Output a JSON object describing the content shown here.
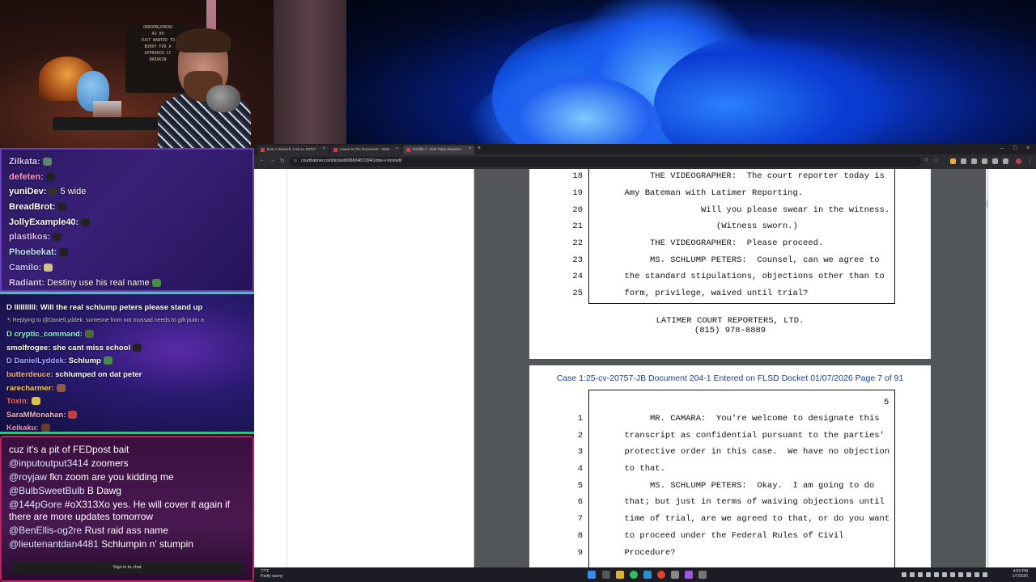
{
  "webcam": {
    "sign_lines": [
      "OKBOOBLEHEAD",
      "AS 80",
      "JUST WANTED TO",
      "BUDDY FOR A",
      "APPROACH CC",
      "BREAKIN"
    ]
  },
  "twitch_chat": [
    {
      "user": "Zilkata:",
      "text": "",
      "color": "#d8c0ff"
    },
    {
      "user": "defeten:",
      "text": "",
      "color": "#ff9ad0"
    },
    {
      "user": "yuniDev:",
      "text": "5 wide",
      "color": "#ffffff"
    },
    {
      "user": "BreadBrot:",
      "text": "",
      "color": "#ffffff"
    },
    {
      "user": "JollyExample40:",
      "text": "",
      "color": "#ffffff"
    },
    {
      "user": "plastikos:",
      "text": "",
      "color": "#e6b8ff"
    },
    {
      "user": "Phoebekat:",
      "text": "",
      "color": "#bfe2ff"
    },
    {
      "user": "Camilo:",
      "text": "",
      "color": "#c8c0ff"
    },
    {
      "user": "Radiant:",
      "text": "Destiny use his real name",
      "color": "#e0c8ff"
    }
  ],
  "twitch_chat2": [
    {
      "user": "D llllllllll:",
      "text": "Will the real schlump peters please stand up",
      "color": "#ffffff"
    },
    {
      "user": "",
      "text": "↰ Replying to @DanielLyddek: someone from not mossad needs to gift putin a",
      "color": "#cccccc"
    },
    {
      "user": "D cryptic_command:",
      "text": "",
      "color": "#7fffd4"
    },
    {
      "user": "smolfrogee:",
      "text": "she cant miss school",
      "color": "#ffffff"
    },
    {
      "user": "D DanielLyddek:",
      "text": "Schlump",
      "color": "#a8a8ff"
    },
    {
      "user": "butterdeuce:",
      "text": "schlumped on dat peter",
      "color": "#ffb07a"
    },
    {
      "user": "rarecharmer:",
      "text": "",
      "color": "#ffd070"
    },
    {
      "user": "Toxin:",
      "text": "",
      "color": "#ff6a6a"
    },
    {
      "user": "SaraMMonahan:",
      "text": "",
      "color": "#ffb0b0"
    },
    {
      "user": "Keikaku:",
      "text": "",
      "color": "#ff8ad0"
    }
  ],
  "youtube_chat": [
    {
      "user": "",
      "text": "cuz it's a pit of FEDpost bait"
    },
    {
      "user": "@inputoutput3414",
      "text": "zoomers"
    },
    {
      "user": "@royjaw",
      "text": "fkn zoom are you kidding me"
    },
    {
      "user": "@BulbSweetBulb",
      "text": "B Dawg"
    },
    {
      "user": "@144pGore",
      "text": "#oX313Xo yes. He will cover it again if"
    },
    {
      "user": "",
      "text": "there are more updates tomorrow"
    },
    {
      "user": "@BenEllis-og2re",
      "text": "Rust raid ass name"
    },
    {
      "user": "@lieutenantdan4481",
      "text": "Schlumpin n' stumpin"
    }
  ],
  "signin_label": "Sign in to chat",
  "browser": {
    "tabs": [
      {
        "title": "Doe v. Bonnell, 1:25-cv-20757"
      },
      {
        "title": "Leave to File Document - #204"
      },
      {
        "title": "Exhibit A - Non Party Depositi..."
      }
    ],
    "url": "courtlistener.com/docket/69650487/204/1/doe-v-bonnell/"
  },
  "document": {
    "page1_lines": [
      {
        "n": "18",
        "text": "          THE VIDEOGRAPHER:  The court reporter today is"
      },
      {
        "n": "19",
        "text": "     Amy Bateman with Latimer Reporting."
      },
      {
        "n": "20",
        "text": "                    Will you please swear in the witness."
      },
      {
        "n": "21",
        "text": "                       (Witness sworn.)"
      },
      {
        "n": "22",
        "text": "          THE VIDEOGRAPHER:  Please proceed."
      },
      {
        "n": "23",
        "text": "          MS. SCHLUMP PETERS:  Counsel, can we agree to"
      },
      {
        "n": "24",
        "text": "     the standard stipulations, objections other than to"
      },
      {
        "n": "25",
        "text": "     form, privilege, waived until trial?"
      }
    ],
    "footer_line1": "LATIMER COURT REPORTERS, LTD.",
    "footer_line2": "(815) 978-8889",
    "page2_header": "Case 1:25-cv-20757-JB   Document 204-1   Entered on FLSD Docket 01/07/2026   Page 7 of 91",
    "page2_number": "5",
    "page2_lines": [
      {
        "n": "1",
        "text": "          MR. CAMARA:  You're welcome to designate this"
      },
      {
        "n": "2",
        "text": "     transcript as confidential pursuant to the parties'"
      },
      {
        "n": "3",
        "text": "     protective order in this case.  We have no objection"
      },
      {
        "n": "4",
        "text": "     to that."
      },
      {
        "n": "5",
        "text": "          MS. SCHLUMP PETERS:  Okay.  I am going to do"
      },
      {
        "n": "6",
        "text": "     that; but just in terms of waiving objections until"
      },
      {
        "n": "7",
        "text": "     time of trial, are we agreed to that, or do you want"
      },
      {
        "n": "8",
        "text": "     to proceed under the Federal Rules of Civil"
      },
      {
        "n": "9",
        "text": "     Procedure?"
      }
    ]
  },
  "taskbar": {
    "weather_temp": "77°F",
    "weather_desc": "Partly sunny",
    "time": "4:59 PM",
    "date": "1/7/2026"
  }
}
